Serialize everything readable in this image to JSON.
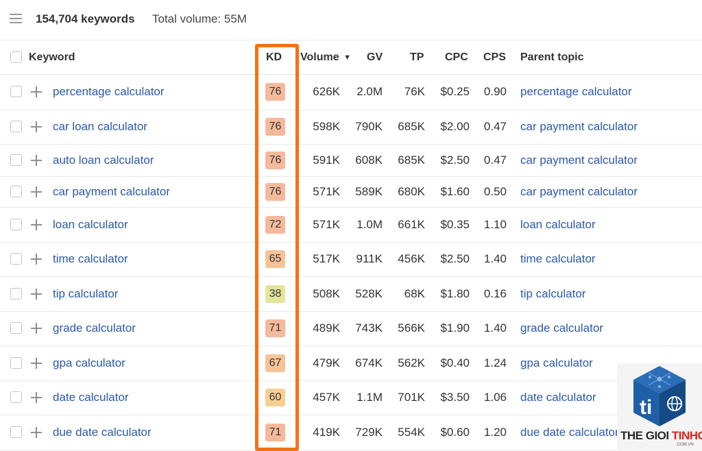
{
  "header": {
    "keyword_count": "154,704 keywords",
    "total_volume": "Total volume: 55M"
  },
  "columns": {
    "keyword": "Keyword",
    "kd": "KD",
    "volume": "Volume",
    "gv": "GV",
    "tp": "TP",
    "cpc": "CPC",
    "cps": "CPS",
    "parent_topic": "Parent topic"
  },
  "sort_indicator": "▼",
  "kd_colors": {
    "high": "#f5b99b",
    "medium_high": "#f6c398",
    "medium": "#f7cf93",
    "low": "#e5e69c"
  },
  "rows": [
    {
      "keyword": "percentage calculator",
      "kd": "76",
      "volume": "626K",
      "gv": "2.0M",
      "tp": "76K",
      "cpc": "$0.25",
      "cps": "0.90",
      "parent": "percentage calculator"
    },
    {
      "keyword": "car loan calculator",
      "kd": "76",
      "volume": "598K",
      "gv": "790K",
      "tp": "685K",
      "cpc": "$2.00",
      "cps": "0.47",
      "parent": "car payment calculator"
    },
    {
      "keyword": "auto loan calculator",
      "kd": "76",
      "volume": "591K",
      "gv": "608K",
      "tp": "685K",
      "cpc": "$2.50",
      "cps": "0.47",
      "parent": "car payment calculator"
    },
    {
      "keyword": "car payment calculator",
      "kd": "76",
      "volume": "571K",
      "gv": "589K",
      "tp": "680K",
      "cpc": "$1.60",
      "cps": "0.50",
      "parent": "car payment calculator"
    },
    {
      "keyword": "loan calculator",
      "kd": "72",
      "volume": "571K",
      "gv": "1.0M",
      "tp": "661K",
      "cpc": "$0.35",
      "cps": "1.10",
      "parent": "loan calculator"
    },
    {
      "keyword": "time calculator",
      "kd": "65",
      "volume": "517K",
      "gv": "911K",
      "tp": "456K",
      "cpc": "$2.50",
      "cps": "1.40",
      "parent": "time calculator"
    },
    {
      "keyword": "tip calculator",
      "kd": "38",
      "volume": "508K",
      "gv": "528K",
      "tp": "68K",
      "cpc": "$1.80",
      "cps": "0.16",
      "parent": "tip calculator"
    },
    {
      "keyword": "grade calculator",
      "kd": "71",
      "volume": "489K",
      "gv": "743K",
      "tp": "566K",
      "cpc": "$1.90",
      "cps": "1.40",
      "parent": "grade calculator"
    },
    {
      "keyword": "gpa calculator",
      "kd": "67",
      "volume": "479K",
      "gv": "674K",
      "tp": "562K",
      "cpc": "$0.40",
      "cps": "1.24",
      "parent": "gpa calculator"
    },
    {
      "keyword": "date calculator",
      "kd": "60",
      "volume": "457K",
      "gv": "1.1M",
      "tp": "701K",
      "cpc": "$3.50",
      "cps": "1.06",
      "parent": "date calculator"
    },
    {
      "keyword": "due date calculator",
      "kd": "71",
      "volume": "419K",
      "gv": "729K",
      "tp": "554K",
      "cpc": "$0.60",
      "cps": "1.20",
      "parent": "due date calculator"
    }
  ],
  "watermark": {
    "brand_part1": "THE GIOI",
    "brand_part2": "TINHOC",
    "domain": ".COM.VN",
    "logo_letters": "ti",
    "colors": {
      "blue": "#1f5fa8",
      "dark_blue": "#164a86",
      "red": "#d7261e"
    }
  }
}
